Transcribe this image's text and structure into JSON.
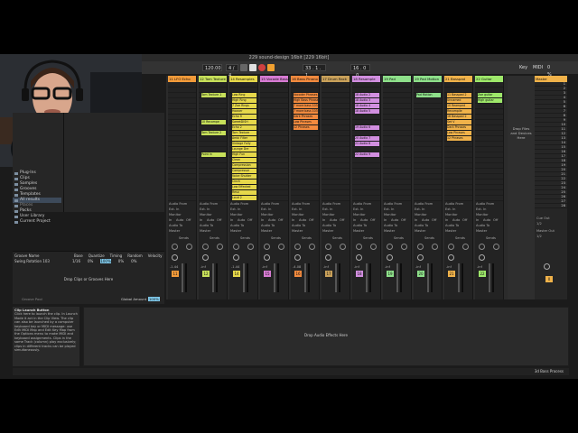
{
  "window": {
    "title": "229 sound-design 16bit  [229 16bit]"
  },
  "transport": {
    "tempo": "120.00",
    "signature": "4 / 4",
    "position": "33 .  1 .  1",
    "loop_end": "16 .  0 .  0",
    "key_label": "Key",
    "midi_label": "MIDI",
    "cpu": "0 %"
  },
  "browser": {
    "items": [
      "Plug-Ins",
      "Clips",
      "Samples",
      "Grooves",
      "Templates",
      "All results"
    ],
    "places_header": "Places",
    "places": [
      "Packs",
      "User Library",
      "Current Project"
    ]
  },
  "groove_pool": {
    "columns": [
      "Groove Name",
      "Base",
      "Quantize",
      "Timing",
      "Random",
      "Velocity"
    ],
    "row": [
      "Swing Rotation 103",
      "1/16",
      "0%",
      "100%",
      "0%",
      "0%"
    ],
    "drop_text": "Drop Clips or Grooves Here",
    "global_amount_label": "Global Amount",
    "global_amount": "100%",
    "footer": "Groove Pool"
  },
  "info_view": {
    "title": "Clip Launch Button",
    "body": "Click here to launch the clip. In Launch Mode it act in the Clip View. The clip can also be launched by a computer keyboard key or MIDI message: use Edit MIDI Map and Edit Key Map from the Options menu to make MIDI and keyboard assignments. Clips in the same Track (column) play exclusively; clips in different tracks can be played simultaneously."
  },
  "devices": {
    "drop_text": "Drop Audio Effects Here"
  },
  "status": {
    "right": "3d Bass Process"
  },
  "tracks": [
    {
      "name": "11 LFO Echo",
      "color": "#f39b3a",
      "clips": [],
      "num": "11",
      "vol": "-1.44"
    },
    {
      "name": "12 Tom Texture 2",
      "color": "#c7e05a",
      "clips": [
        {
          "row": 2,
          "label": "Tom Texture 1"
        },
        {
          "row": 7,
          "label": "10 Recompe"
        },
        {
          "row": 9,
          "label": "Tom Texture 2"
        },
        {
          "row": 13,
          "label": "Point In"
        }
      ],
      "num": "12",
      "vol": "-inf"
    },
    {
      "name": "14 Resamples",
      "color": "#e6d84a",
      "clips": [
        {
          "row": 2,
          "label": "Low Ring"
        },
        {
          "row": 3,
          "label": "High Ring"
        },
        {
          "row": 4,
          "label": "7 Zoe Rings"
        },
        {
          "row": 5,
          "label": "Hoover"
        },
        {
          "row": 6,
          "label": "Echo 9"
        },
        {
          "row": 7,
          "label": "SweetDISH"
        },
        {
          "row": 8,
          "label": "Echo 2"
        },
        {
          "row": 9,
          "label": "Tom Texture"
        },
        {
          "row": 10,
          "label": "Ambi Filter"
        },
        {
          "row": 11,
          "label": "Vintage Folly"
        },
        {
          "row": 12,
          "label": "Lounge Dre"
        },
        {
          "row": 13,
          "label": "High Fun"
        },
        {
          "row": 14,
          "label": "Clean"
        },
        {
          "row": 15,
          "label": "Compression"
        },
        {
          "row": 16,
          "label": "Compressor"
        },
        {
          "row": 17,
          "label": "Voice Shutter"
        },
        {
          "row": 18,
          "label": "Cinch"
        },
        {
          "row": 19,
          "label": "Low Effected"
        },
        {
          "row": 20,
          "label": "Reso"
        },
        {
          "row": 21,
          "label": "Loud 2"
        }
      ],
      "num": "14",
      "vol": "-1.44"
    },
    {
      "name": "15 Vocode Bass",
      "color": "#d77bd3",
      "clips": [],
      "num": "15",
      "vol": "-inf"
    },
    {
      "name": "16 Bass Pinano",
      "color": "#f28a3e",
      "clips": [
        {
          "row": 2,
          "label": "Vocoder Phrases"
        },
        {
          "row": 3,
          "label": "High Bass Phrases"
        },
        {
          "row": 4,
          "label": "7 more  bass  103"
        },
        {
          "row": 5,
          "label": "7 more  bass  103"
        },
        {
          "row": 6,
          "label": "Dark Phrases"
        },
        {
          "row": 7,
          "label": "Low Phrases"
        },
        {
          "row": 8,
          "label": "12 Phrases"
        }
      ],
      "num": "16",
      "vol": "-4.08"
    },
    {
      "name": "17 Drum Rack",
      "color": "#c9a15a",
      "clips": [],
      "num": "17",
      "vol": "-inf"
    },
    {
      "name": "18 Resample",
      "color": "#d28fe0",
      "clips": [
        {
          "row": 2,
          "label": "18 Audio 2"
        },
        {
          "row": 3,
          "label": "18 Audio 3"
        },
        {
          "row": 4,
          "label": "18 Audio 4"
        },
        {
          "row": 5,
          "label": "18 Audio 5"
        },
        {
          "row": 8,
          "label": "19 Audio 6"
        },
        {
          "row": 10,
          "label": "20 Audio 7"
        },
        {
          "row": 11,
          "label": "21 Audio 8"
        },
        {
          "row": 13,
          "label": "22 Audio 9"
        }
      ],
      "num": "18",
      "vol": "-inf"
    },
    {
      "name": "19 Pad",
      "color": "#8ee08a",
      "clips": [],
      "num": "19",
      "vol": "-inf"
    },
    {
      "name": "19 Pad Motion",
      "color": "#8ee08a",
      "clips": [
        {
          "row": 2,
          "label": "Pad Motion"
        }
      ],
      "num": "20",
      "vol": "-inf"
    },
    {
      "name": "21 Basspad",
      "color": "#f0b24a",
      "clips": [
        {
          "row": 2,
          "label": "11 Basspad 2"
        },
        {
          "row": 3,
          "label": "Unnamed"
        },
        {
          "row": 4,
          "label": "10 Reamped"
        },
        {
          "row": 5,
          "label": "Recompile"
        },
        {
          "row": 6,
          "label": "16 Basspad 2"
        },
        {
          "row": 7,
          "label": "Set V"
        },
        {
          "row": 8,
          "label": "Dark Phrases"
        },
        {
          "row": 9,
          "label": "Low Phrases"
        },
        {
          "row": 10,
          "label": "12 Phrases"
        }
      ],
      "num": "21",
      "vol": "-inf"
    },
    {
      "name": "22 Guitar",
      "color": "#9ee86a",
      "clips": [
        {
          "row": 2,
          "label": "Zoe guitar"
        },
        {
          "row": 3,
          "label": "High guitar"
        }
      ],
      "num": "22",
      "vol": "-inf"
    }
  ],
  "dropzone": {
    "text": "Drop Files and Devices Here"
  },
  "master": {
    "name": "Master",
    "scene_numbers": [
      "1",
      "2",
      "3",
      "4",
      "5",
      "6",
      "7",
      "8",
      "9",
      "10",
      "11",
      "12",
      "13",
      "14",
      "15",
      "16",
      "17",
      "18",
      "19",
      "20",
      "21",
      "22",
      "23",
      "24",
      "25",
      "26",
      "27",
      "28"
    ],
    "vol": "0",
    "cue_out": "Cue Out",
    "cue_out_val": "1/2",
    "master_out": "Master Out",
    "master_out_val": "1/2"
  },
  "mixer": {
    "audio_to": "Audio To",
    "master_label": "Master",
    "sends_label": "Sends",
    "monitor_label": "Monitor",
    "monitor_options": [
      "In",
      "Auto",
      "Off"
    ],
    "audio_from": "Audio From",
    "ext_in": "Ext. In",
    "midi_from": "MIDI From",
    "all_ins": "All Ins",
    "all_channels": "All Channels"
  }
}
